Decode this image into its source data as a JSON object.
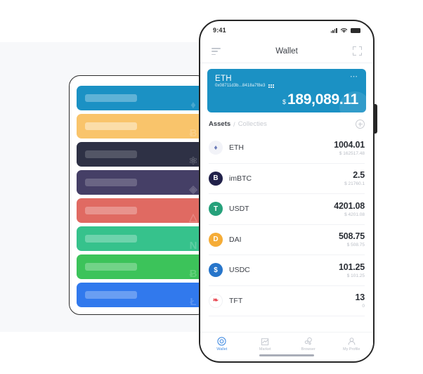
{
  "phone": {
    "statusbar": {
      "time": "9:41",
      "signal_icon": "signal-bars-icon",
      "wifi_icon": "wifi-icon",
      "battery_icon": "battery-icon"
    },
    "appbar": {
      "title": "Wallet",
      "menu_icon": "menu-icon",
      "scan_icon": "scan-icon"
    },
    "balance_card": {
      "symbol": "ETH",
      "address": "0x08711d3b...8418a7f8e3",
      "qr_icon": "qr-code-icon",
      "more_icon": "more-options-icon",
      "currency": "$",
      "amount": "189,089.11",
      "color": "#1b91c4"
    },
    "tabs": {
      "active": "Assets",
      "separator": "/",
      "inactive": "Collecties",
      "add_icon": "add-asset-icon"
    },
    "assets": [
      {
        "symbol": "ETH",
        "glyph": "♦",
        "color": "#f2f3f8",
        "glyph_color": "#6b7bb8",
        "amount": "1004.01",
        "sub": "$ 162517.48"
      },
      {
        "symbol": "imBTC",
        "glyph": "B",
        "color": "#21214a",
        "glyph_color": "#ffffff",
        "amount": "2.5",
        "sub": "$ 21760.1"
      },
      {
        "symbol": "USDT",
        "glyph": "T",
        "color": "#26a17b",
        "glyph_color": "#ffffff",
        "amount": "4201.08",
        "sub": "$ 4201.08"
      },
      {
        "symbol": "DAI",
        "glyph": "D",
        "color": "#f5ac37",
        "glyph_color": "#ffffff",
        "amount": "508.75",
        "sub": "$ 508.75"
      },
      {
        "symbol": "USDC",
        "glyph": "$",
        "color": "#2775ca",
        "glyph_color": "#ffffff",
        "amount": "101.25",
        "sub": "$ 101.25"
      },
      {
        "symbol": "TFT",
        "glyph": "❧",
        "color": "#ffffff",
        "glyph_color": "#e8444f",
        "amount": "13",
        "sub": "0"
      }
    ],
    "nav": [
      {
        "label": "Wallet",
        "icon": "wallet-icon",
        "active": true
      },
      {
        "label": "Market",
        "icon": "chart-icon",
        "active": false
      },
      {
        "label": "Browser",
        "icon": "browser-icon",
        "active": false
      },
      {
        "label": "My Profile",
        "icon": "profile-icon",
        "active": false
      }
    ]
  },
  "card_stack": [
    {
      "color": "#1b91c4",
      "bar": "rgba(255,255,255,0.30)",
      "mark": "♦",
      "name": "eth-card"
    },
    {
      "color": "#f9c46b",
      "bar": "rgba(255,255,255,0.42)",
      "mark": "Ƀ",
      "name": "btc-card"
    },
    {
      "color": "#2e3145",
      "bar": "rgba(255,255,255,0.18)",
      "mark": "⚛",
      "name": "atom-card"
    },
    {
      "color": "#453f66",
      "bar": "rgba(255,255,255,0.20)",
      "mark": "◈",
      "name": "eos-card"
    },
    {
      "color": "#e06a62",
      "bar": "rgba(255,255,255,0.28)",
      "mark": "△",
      "name": "trx-card"
    },
    {
      "color": "#36c28c",
      "bar": "rgba(255,255,255,0.28)",
      "mark": "N",
      "name": "neo-card"
    },
    {
      "color": "#3cc35a",
      "bar": "rgba(255,255,255,0.28)",
      "mark": "Ƀ",
      "name": "bch-card"
    },
    {
      "color": "#3179ed",
      "bar": "rgba(255,255,255,0.28)",
      "mark": "Ł",
      "name": "ltc-card"
    }
  ]
}
